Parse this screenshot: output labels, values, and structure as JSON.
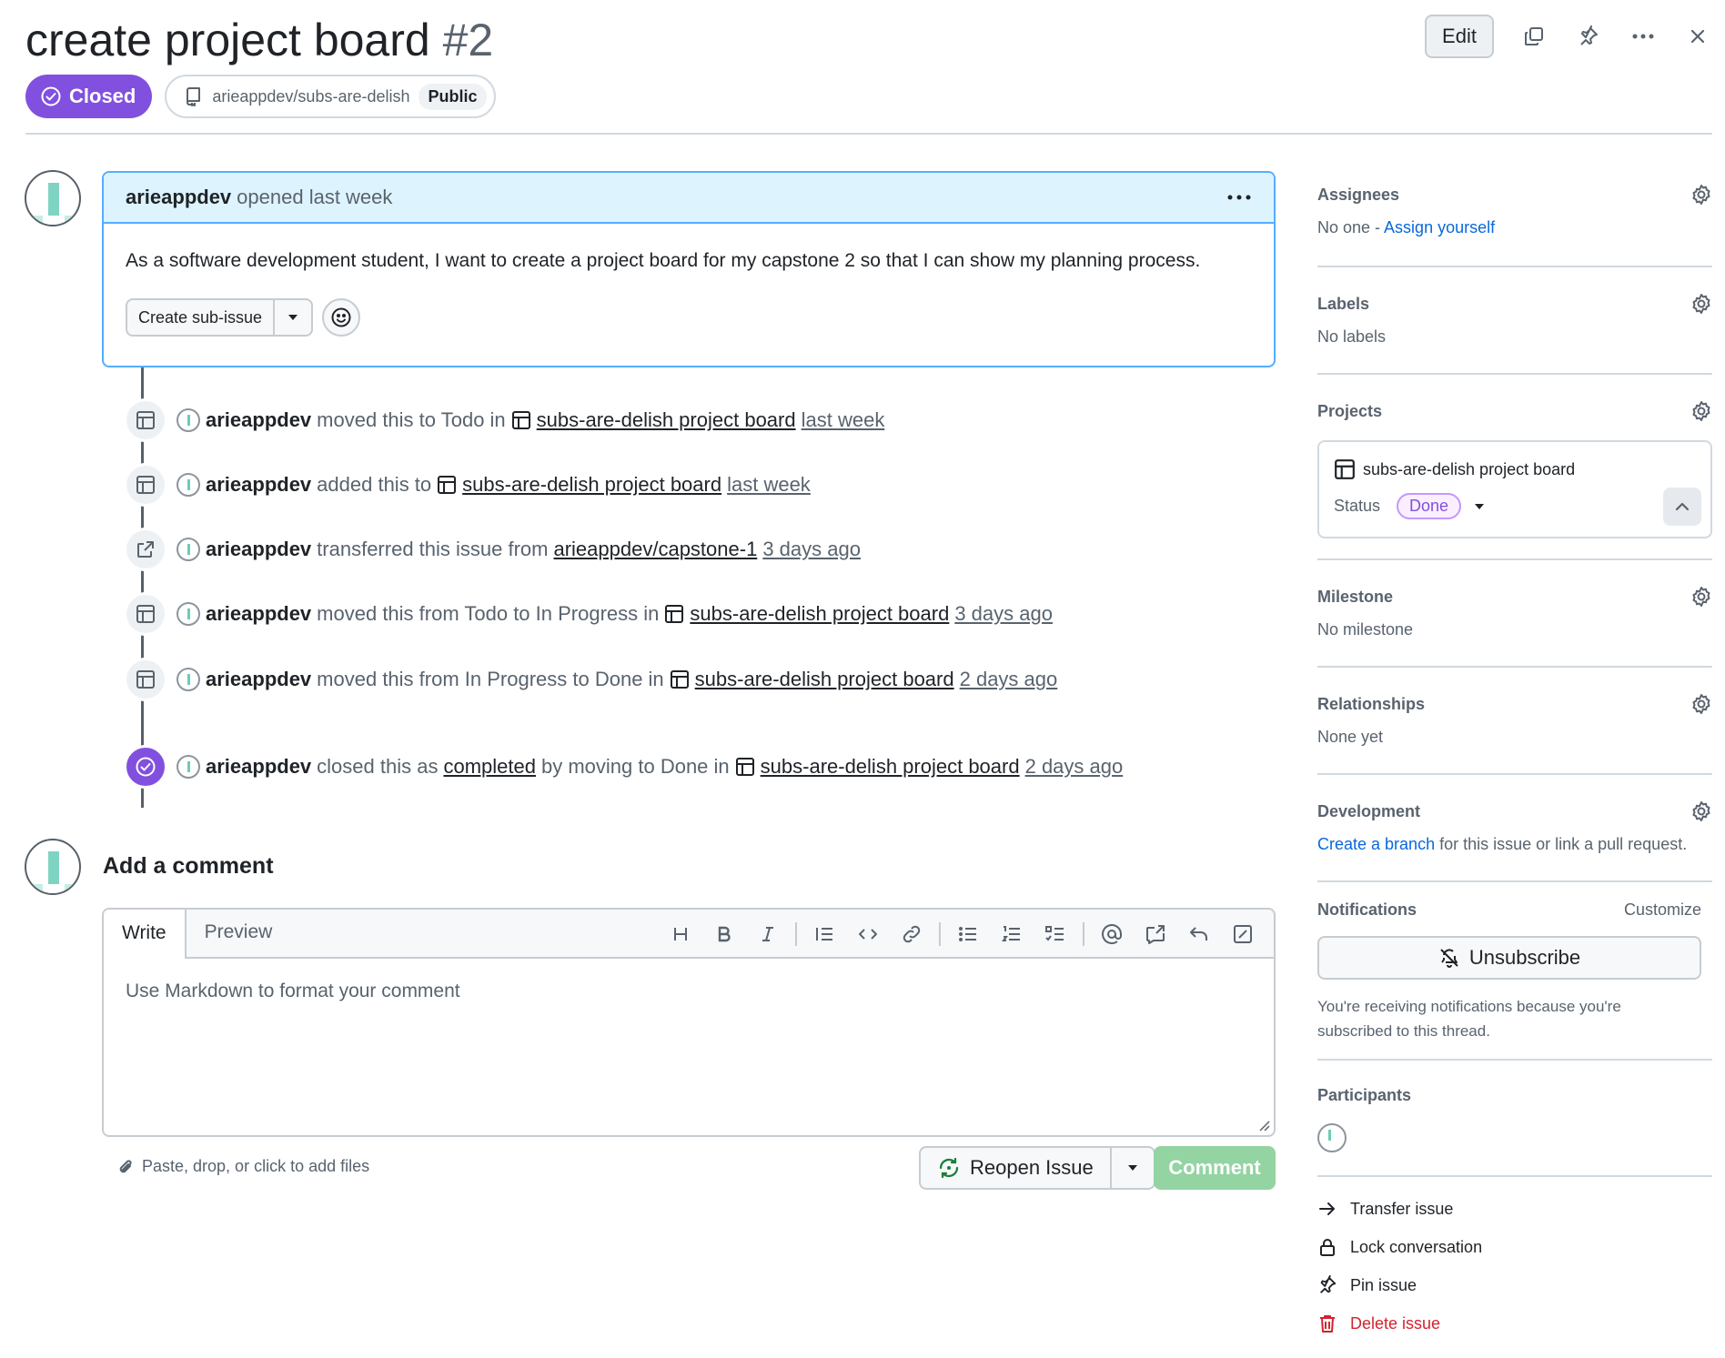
{
  "issue": {
    "title": "create project board",
    "number": "#2",
    "state": "Closed",
    "repo": "arieappdev/subs-are-delish",
    "visibility": "Public",
    "edit_label": "Edit"
  },
  "body": {
    "author": "arieappdev",
    "opened_text": "opened last week",
    "text": "As a software development student, I want to create a project board for my capstone 2 so that I can show my planning process.",
    "create_sub_issue_label": "Create sub-issue"
  },
  "timeline": [
    {
      "actor": "arieappdev",
      "pre": "moved this to Todo in",
      "link": "subs-are-delish project board",
      "mid": "",
      "time": "last week",
      "icon": "table-icon"
    },
    {
      "actor": "arieappdev",
      "pre": "added this to",
      "link": "subs-are-delish project board",
      "mid": "",
      "time": "last week",
      "icon": "table-icon"
    },
    {
      "actor": "arieappdev",
      "pre": "transferred this issue from",
      "link": "arieappdev/capstone-1",
      "mid": "",
      "time": "3 days ago",
      "icon": "transfer-icon"
    },
    {
      "actor": "arieappdev",
      "pre": "moved this from Todo to In Progress in",
      "link": "subs-are-delish project board",
      "mid": "",
      "time": "3 days ago",
      "icon": "table-icon"
    },
    {
      "actor": "arieappdev",
      "pre": "moved this from In Progress to Done in",
      "link": "subs-are-delish project board",
      "mid": "",
      "time": "2 days ago",
      "icon": "table-icon"
    },
    {
      "actor": "arieappdev",
      "pre": "closed this as",
      "completed": "completed",
      "mid": "by moving to Done in",
      "link": "subs-are-delish project board",
      "time": "2 days ago",
      "icon": "check-circle-icon"
    }
  ],
  "comment": {
    "title": "Add a comment",
    "tab_write": "Write",
    "tab_preview": "Preview",
    "placeholder": "Use Markdown to format your comment",
    "attach_text": "Paste, drop, or click to add files",
    "reopen_label": "Reopen Issue",
    "comment_label": "Comment"
  },
  "sidebar": {
    "assignees": {
      "heading": "Assignees",
      "none": "No one - ",
      "assign_link": "Assign yourself"
    },
    "labels": {
      "heading": "Labels",
      "value": "No labels"
    },
    "projects": {
      "heading": "Projects",
      "project_name": "subs-are-delish project board",
      "status_label": "Status",
      "status_value": "Done"
    },
    "milestone": {
      "heading": "Milestone",
      "value": "No milestone"
    },
    "relationships": {
      "heading": "Relationships",
      "value": "None yet"
    },
    "development": {
      "heading": "Development",
      "link": "Create a branch",
      "rest": " for this issue or link a pull request."
    },
    "notifications": {
      "heading": "Notifications",
      "customize": "Customize",
      "unsubscribe": "Unsubscribe",
      "note": "You're receiving notifications because you're subscribed to this thread."
    },
    "participants": {
      "heading": "Participants"
    },
    "actions": {
      "transfer": "Transfer issue",
      "lock": "Lock conversation",
      "pin": "Pin issue",
      "delete": "Delete issue"
    }
  },
  "colors": {
    "closed": "#8250df",
    "link": "#0969da",
    "danger": "#d1242f",
    "comment_disabled": "#94d3a2",
    "body_border": "#54aeff"
  }
}
